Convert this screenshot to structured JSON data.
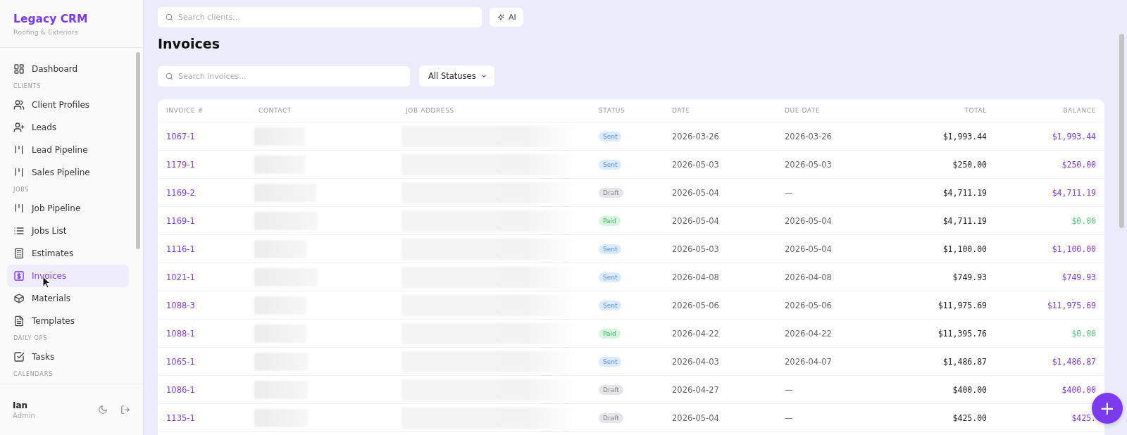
{
  "brand": {
    "title": "Legacy CRM",
    "subtitle": "Roofing & Exteriors"
  },
  "sidebar": {
    "items": [
      {
        "kind": "link",
        "label": "Dashboard",
        "selected": false
      },
      {
        "kind": "section",
        "label": "CLIENTS"
      },
      {
        "kind": "link",
        "label": "Client Profiles",
        "selected": false
      },
      {
        "kind": "link",
        "label": "Leads",
        "selected": false
      },
      {
        "kind": "link",
        "label": "Lead Pipeline",
        "selected": false
      },
      {
        "kind": "link",
        "label": "Sales Pipeline",
        "selected": false
      },
      {
        "kind": "section",
        "label": "JOBS"
      },
      {
        "kind": "link",
        "label": "Job Pipeline",
        "selected": false
      },
      {
        "kind": "link",
        "label": "Jobs List",
        "selected": false
      },
      {
        "kind": "link",
        "label": "Estimates",
        "selected": false
      },
      {
        "kind": "link",
        "label": "Invoices",
        "selected": true
      },
      {
        "kind": "link",
        "label": "Materials",
        "selected": false
      },
      {
        "kind": "link",
        "label": "Templates",
        "selected": false
      },
      {
        "kind": "section",
        "label": "DAILY OPS"
      },
      {
        "kind": "link",
        "label": "Tasks",
        "selected": false
      },
      {
        "kind": "section",
        "label": "CALENDARS"
      }
    ]
  },
  "user": {
    "name": "Ian",
    "role": "Admin"
  },
  "topbar": {
    "search": {
      "placeholder": "Search clients..."
    },
    "ai_button": "AI"
  },
  "page_title": "Invoices",
  "filters": {
    "search": {
      "placeholder": "Search invoices..."
    },
    "status": "All Statuses"
  },
  "table": {
    "columns": [
      "INVOICE #",
      "CONTACT",
      "JOB ADDRESS",
      "STATUS",
      "DATE",
      "DUE DATE",
      "TOTAL",
      "BALANCE"
    ],
    "rows": [
      {
        "invoice": "1067-1",
        "status": "Sent",
        "kind": "sent",
        "date": "2026-03-26",
        "due": "2026-03-26",
        "total": "$1,993.44",
        "balance": "$1,993.44"
      },
      {
        "invoice": "1179-1",
        "status": "Sent",
        "kind": "sent",
        "date": "2026-05-03",
        "due": "2026-05-03",
        "total": "$250.00",
        "balance": "$250.00"
      },
      {
        "invoice": "1169-2",
        "status": "Draft",
        "kind": "draft",
        "date": "2026-05-04",
        "due": "—",
        "total": "$4,711.19",
        "balance": "$4,711.19"
      },
      {
        "invoice": "1169-1",
        "status": "Paid",
        "kind": "paid",
        "date": "2026-05-04",
        "due": "2026-05-04",
        "total": "$4,711.19",
        "balance": "$0.00"
      },
      {
        "invoice": "1116-1",
        "status": "Sent",
        "kind": "sent",
        "date": "2026-05-03",
        "due": "2026-05-04",
        "total": "$1,100.00",
        "balance": "$1,100.00"
      },
      {
        "invoice": "1021-1",
        "status": "Sent",
        "kind": "sent",
        "date": "2026-04-08",
        "due": "2026-04-08",
        "total": "$749.93",
        "balance": "$749.93"
      },
      {
        "invoice": "1088-3",
        "status": "Sent",
        "kind": "sent",
        "date": "2026-05-06",
        "due": "2026-05-06",
        "total": "$11,975.69",
        "balance": "$11,975.69"
      },
      {
        "invoice": "1088-1",
        "status": "Paid",
        "kind": "paid",
        "date": "2026-04-22",
        "due": "2026-04-22",
        "total": "$11,395.76",
        "balance": "$0.00"
      },
      {
        "invoice": "1065-1",
        "status": "Sent",
        "kind": "sent",
        "date": "2026-04-03",
        "due": "2026-04-07",
        "total": "$1,486.87",
        "balance": "$1,486.87"
      },
      {
        "invoice": "1086-1",
        "status": "Draft",
        "kind": "draft",
        "date": "2026-04-27",
        "due": "—",
        "total": "$400.00",
        "balance": "$400.00"
      },
      {
        "invoice": "1135-1",
        "status": "Draft",
        "kind": "draft",
        "date": "2026-05-04",
        "due": "—",
        "total": "$425.00",
        "balance": "$425."
      }
    ]
  },
  "fab": "+"
}
